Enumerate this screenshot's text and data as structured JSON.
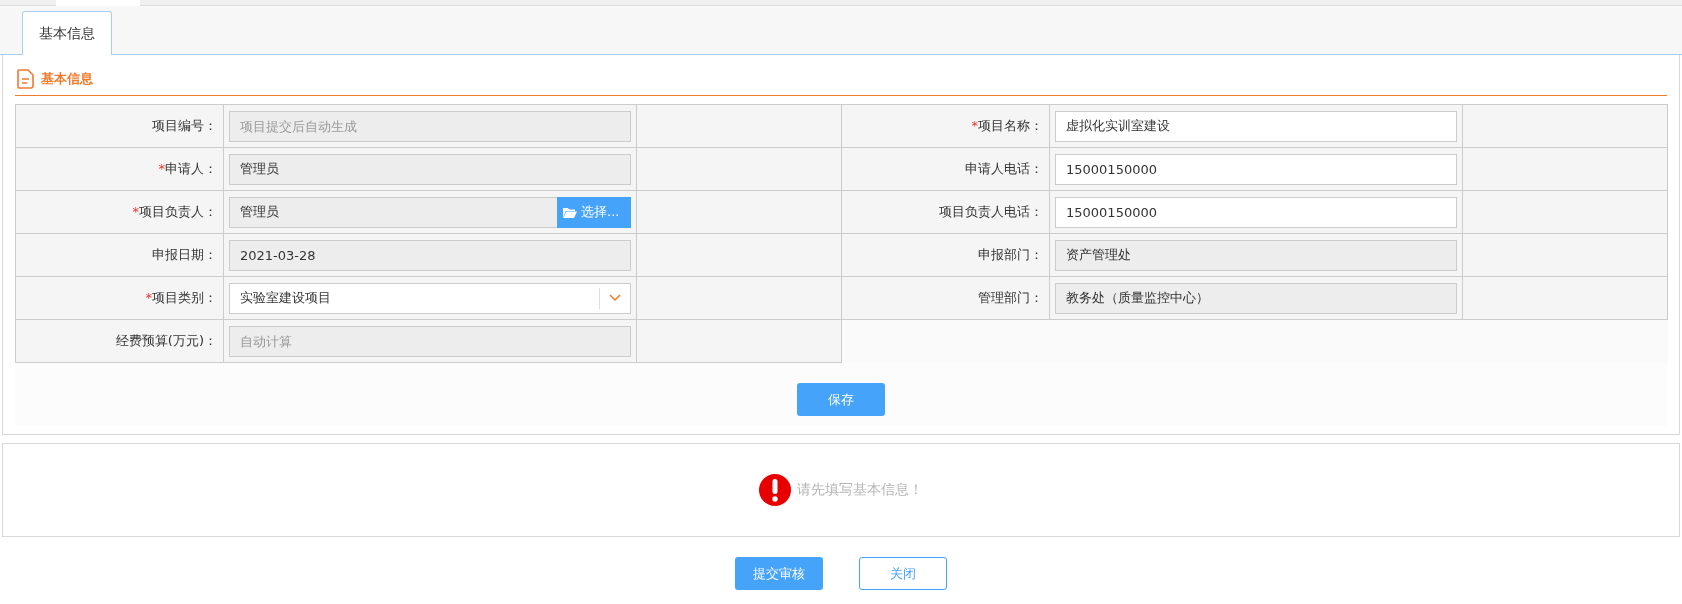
{
  "tabs": [
    {
      "label": "基本信息",
      "selected": true
    }
  ],
  "section": {
    "title": "基本信息"
  },
  "required_mark": "*",
  "rows": [
    {
      "left": {
        "label": "项目编号：",
        "required": false,
        "field": {
          "kind": "readonly",
          "placeholder": "项目提交后自动生成"
        }
      },
      "right": {
        "label": "项目名称：",
        "required": true,
        "field": {
          "kind": "text",
          "value": "虚拟化实训室建设"
        }
      }
    },
    {
      "left": {
        "label": "申请人：",
        "required": true,
        "field": {
          "kind": "readonly",
          "value": "管理员"
        }
      },
      "right": {
        "label": "申请人电话：",
        "required": false,
        "field": {
          "kind": "text",
          "value": "15000150000"
        }
      }
    },
    {
      "left": {
        "label": "项目负责人：",
        "required": true,
        "field": {
          "kind": "picker",
          "value": "管理员",
          "button": "选择..."
        }
      },
      "right": {
        "label": "项目负责人电话：",
        "required": false,
        "field": {
          "kind": "text",
          "value": "15000150000"
        }
      }
    },
    {
      "left": {
        "label": "申报日期：",
        "required": false,
        "field": {
          "kind": "readonly",
          "value": "2021-03-28"
        }
      },
      "right": {
        "label": "申报部门：",
        "required": false,
        "field": {
          "kind": "readonly",
          "value": "资产管理处"
        }
      }
    },
    {
      "left": {
        "label": "项目类别：",
        "required": true,
        "field": {
          "kind": "select",
          "value": "实验室建设项目"
        }
      },
      "right": {
        "label": "管理部门：",
        "required": false,
        "field": {
          "kind": "readonly",
          "value": "教务处（质量监控中心）"
        }
      }
    },
    {
      "left": {
        "label": "经费预算(万元)：",
        "required": false,
        "field": {
          "kind": "readonly",
          "placeholder": "自动计算"
        }
      }
    }
  ],
  "save_button": "保存",
  "notice": "请先填写基本信息！",
  "footer_buttons": [
    {
      "label": "提交审核",
      "kind": "primary"
    },
    {
      "label": "关闭",
      "kind": "outline"
    }
  ]
}
